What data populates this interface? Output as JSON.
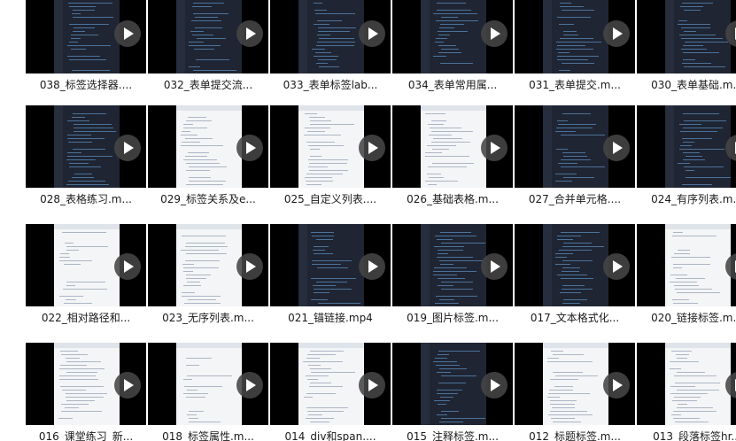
{
  "files": [
    {
      "name": "038_标签选择器....",
      "style": "dark"
    },
    {
      "name": "032_表单提交流...",
      "style": "dark"
    },
    {
      "name": "033_表单标签lab...",
      "style": "dark"
    },
    {
      "name": "034_表单常用属...",
      "style": "dark"
    },
    {
      "name": "031_表单提交.m...",
      "style": "dark"
    },
    {
      "name": "030_表单基础.m...",
      "style": "dark"
    },
    {
      "name": "028_表格练习.m...",
      "style": "dark"
    },
    {
      "name": "029_标签关系及e...",
      "style": "light"
    },
    {
      "name": "025_自定义列表....",
      "style": "light"
    },
    {
      "name": "026_基础表格.m...",
      "style": "light"
    },
    {
      "name": "027_合并单元格....",
      "style": "dark"
    },
    {
      "name": "024_有序列表.m...",
      "style": "dark"
    },
    {
      "name": "022_相对路径和...",
      "style": "light"
    },
    {
      "name": "023_无序列表.m...",
      "style": "light"
    },
    {
      "name": "021_锚链接.mp4",
      "style": "dark"
    },
    {
      "name": "019_图片标签.m...",
      "style": "dark"
    },
    {
      "name": "017_文本格式化...",
      "style": "dark"
    },
    {
      "name": "020_链接标签.m...",
      "style": "light"
    },
    {
      "name": "016_课堂练习_新...",
      "style": "light"
    },
    {
      "name": "018_标签属性.m...",
      "style": "light"
    },
    {
      "name": "014_div和span....",
      "style": "light"
    },
    {
      "name": "015_注释标签.m...",
      "style": "dark"
    },
    {
      "name": "012_标题标签.m...",
      "style": "light"
    },
    {
      "name": "013_段落标签hr...",
      "style": "light"
    }
  ]
}
